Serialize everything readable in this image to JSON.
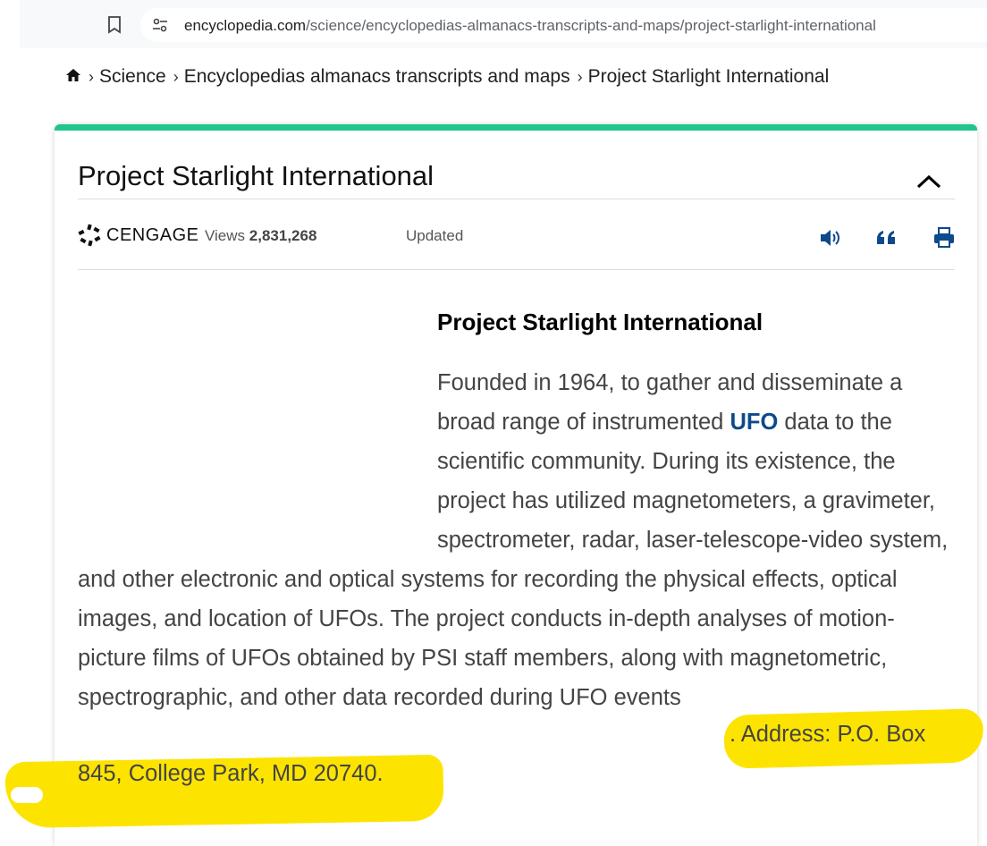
{
  "browser": {
    "url_host": "encyclopedia.com",
    "url_path": "/science/encyclopedias-almanacs-transcripts-and-maps/project-starlight-international",
    "bookmark_icon": "bookmark-icon",
    "site_info_icon": "tune-icon"
  },
  "breadcrumb": {
    "home_icon": "home-icon",
    "items": [
      "Science",
      "Encyclopedias almanacs transcripts and maps",
      "Project Starlight International"
    ]
  },
  "card": {
    "title": "Project Starlight International",
    "accent_color": "#21c48d",
    "publisher": "CENGAGE",
    "views_label": "Views",
    "views_count": "2,831,268",
    "updated_label": "Updated",
    "tools": [
      "speaker-icon",
      "quote-icon",
      "print-icon"
    ]
  },
  "article": {
    "heading": "Project Starlight International",
    "text_before_link": "Founded in 1964, to gather and disseminate a broad range of instrumented ",
    "link_text": "UFO",
    "text_after_link": " data to the scientific community. During its existence, the project has utilized magnetometers, a gravimeter, spectrometer, radar, laser-telescope-video system, and other electronic and optical systems for recording the physical effects, optical images, and location of UFOs. The project conducts in-depth analyses of motion-picture films of UFOs obtained by PSI staff members, along with magnetometric, spectrographic, and other data recorded during UFO events",
    "address_line1": ". Address: P.O. Box",
    "address_line2": "845, College Park, MD 20740."
  },
  "highlight_color": "#fde400"
}
